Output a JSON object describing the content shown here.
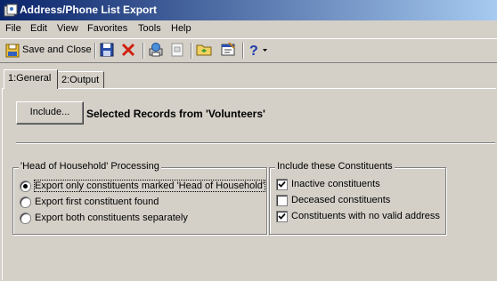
{
  "window": {
    "title": "Address/Phone List Export"
  },
  "menu": [
    "File",
    "Edit",
    "View",
    "Favorites",
    "Tools",
    "Help"
  ],
  "toolbar": {
    "save_close_label": "Save and Close"
  },
  "tabs": [
    {
      "label": "1:General",
      "active": true
    },
    {
      "label": "2:Output",
      "active": false
    }
  ],
  "general": {
    "include_button": "Include...",
    "selected_records": "Selected Records from 'Volunteers'",
    "hoh_group": {
      "legend": "'Head of Household' Processing",
      "options": [
        {
          "label": "Export only constituents marked 'Head of Household'",
          "selected": true
        },
        {
          "label": "Export first constituent found",
          "selected": false
        },
        {
          "label": "Export both constituents separately",
          "selected": false
        }
      ]
    },
    "include_group": {
      "legend": "Include these Constituents",
      "options": [
        {
          "label": "Inactive constituents",
          "checked": true
        },
        {
          "label": "Deceased constituents",
          "checked": false
        },
        {
          "label": "Constituents with no valid address",
          "checked": true
        }
      ]
    }
  },
  "colors": {
    "title_start": "#0a246a",
    "title_end": "#a6caf0",
    "face": "#d4d0c8"
  }
}
